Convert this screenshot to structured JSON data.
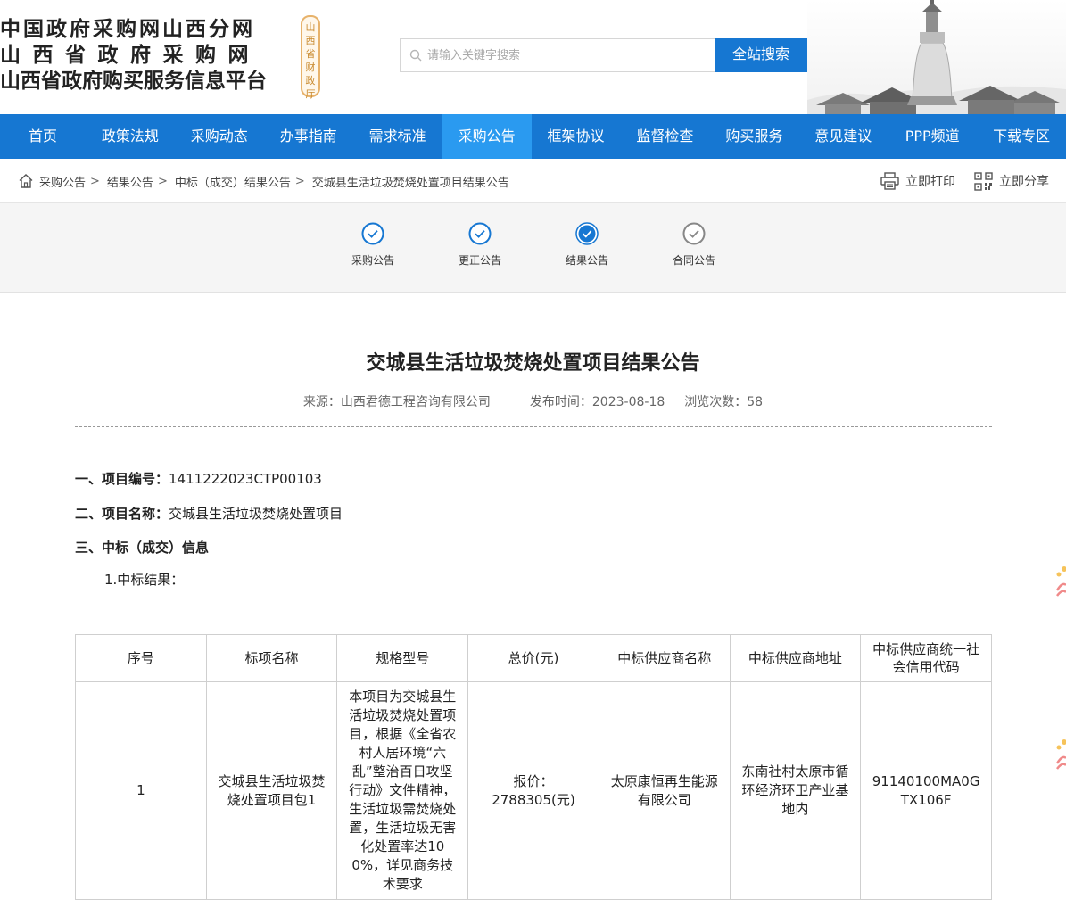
{
  "header": {
    "logo_line1": "中国政府采购网山西分网",
    "logo_line2": "山西省政府采购网",
    "logo_line3": "山西省政府购买服务信息平台",
    "seal_text": "山西省财政厅",
    "search_placeholder": "请输入关键字搜索",
    "search_button": "全站搜索"
  },
  "nav": {
    "items": [
      "首页",
      "政策法规",
      "采购动态",
      "办事指南",
      "需求标准",
      "采购公告",
      "框架协议",
      "监督检查",
      "购买服务",
      "意见建议",
      "PPP频道",
      "下载专区"
    ],
    "active_index": 5
  },
  "breadcrumb": {
    "items": [
      "采购公告",
      "结果公告",
      "中标（成交）结果公告",
      "交城县生活垃圾焚烧处置项目结果公告"
    ],
    "separator": ">"
  },
  "tools": {
    "print": "立即打印",
    "share": "立即分享"
  },
  "steps": [
    {
      "label": "采购公告",
      "state": "done"
    },
    {
      "label": "更正公告",
      "state": "done"
    },
    {
      "label": "结果公告",
      "state": "current"
    },
    {
      "label": "合同公告",
      "state": "pending"
    }
  ],
  "article": {
    "title": "交城县生活垃圾焚烧处置项目结果公告",
    "source_label": "来源：",
    "source": "山西君德工程咨询有限公司",
    "date_label": "发布时间：",
    "date": "2023-08-18",
    "views_label": "浏览次数：",
    "views": "58",
    "section1_label": "一、项目编号：",
    "section1_value": "1411222023CTP00103",
    "section2_label": "二、项目名称：",
    "section2_value": "交城县生活垃圾焚烧处置项目",
    "section3_label": "三、中标（成交）信息",
    "sub1": "1.中标结果："
  },
  "table": {
    "headers": [
      "序号",
      "标项名称",
      "规格型号",
      "总价(元)",
      "中标供应商名称",
      "中标供应商地址",
      "中标供应商统一社会信用代码"
    ],
    "rows": [
      {
        "no": "1",
        "item_name": "交城县生活垃圾焚烧处置项目包1",
        "spec": "本项目为交城县生活垃圾焚烧处置项目，根据《全省农村人居环境“六乱”整治百日攻坚行动》文件精神，生活垃圾需焚烧处置，生活垃圾无害化处置率达100%，详见商务技术要求",
        "price": "报价：2788305(元)",
        "supplier": "太原康恒再生能源有限公司",
        "address": "东南社村太原市循环经济环卫产业基地内",
        "credit_code": "91140100MA0GTX106F"
      }
    ]
  },
  "colors": {
    "nav_bg": "#1677d2",
    "nav_active": "#2a9af0",
    "step_blue": "#1677d2"
  }
}
